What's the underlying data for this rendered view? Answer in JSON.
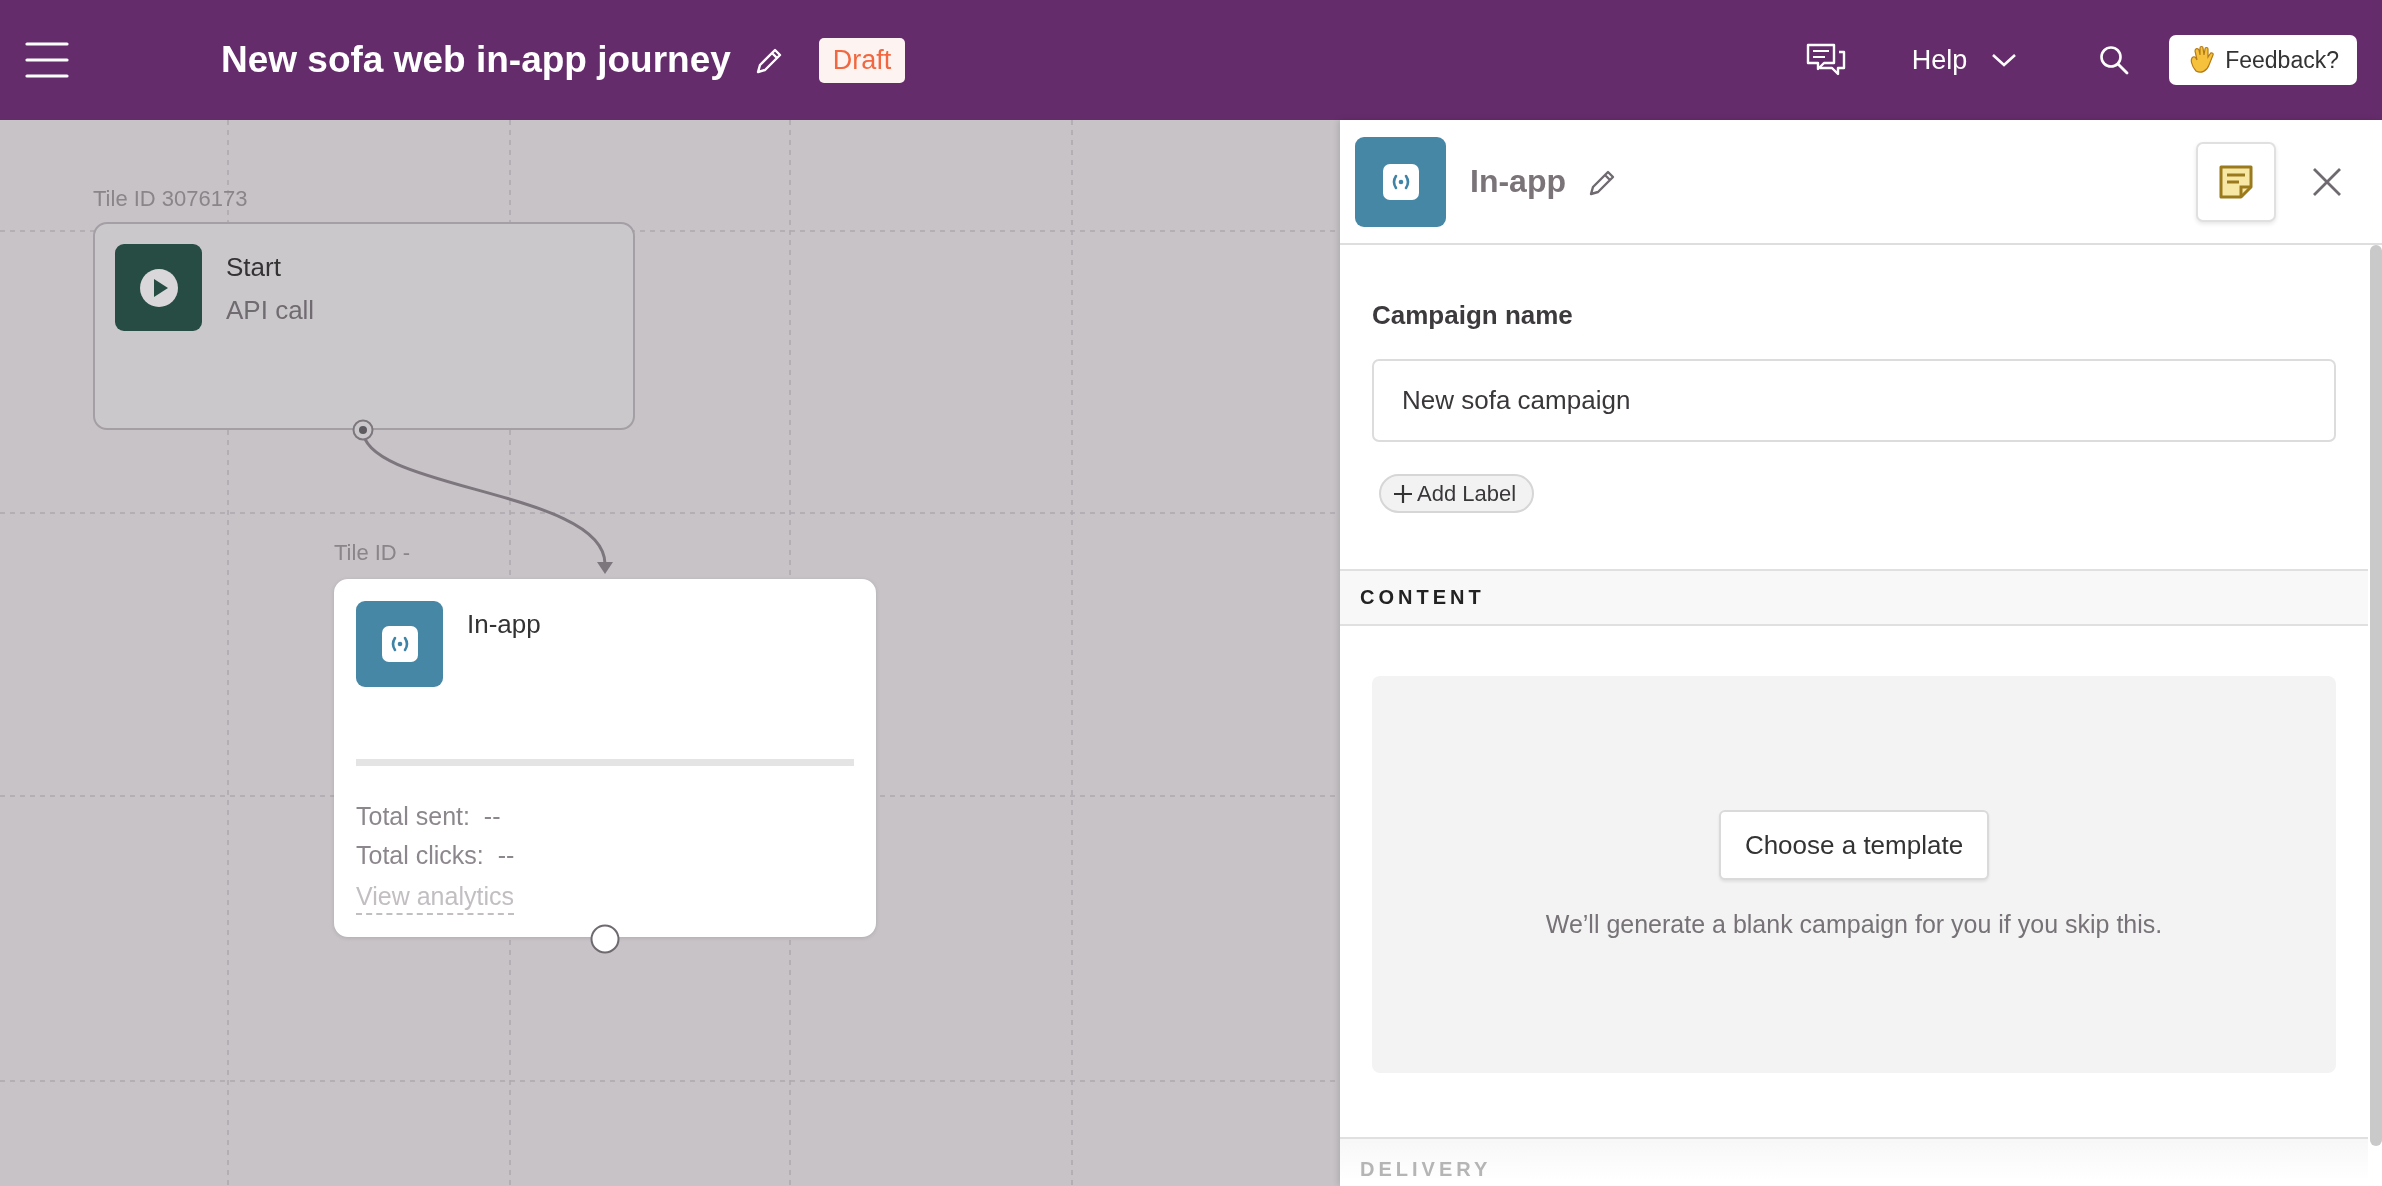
{
  "header": {
    "title": "New sofa web in-app journey",
    "status_badge": "Draft",
    "help_menu": "Help",
    "feedback_button": "Feedback?"
  },
  "canvas": {
    "tiles": [
      {
        "kind": "start",
        "tile_id": "Tile ID 3076173",
        "title": "Start",
        "subtitle": "API call",
        "selected": false
      },
      {
        "kind": "in_app",
        "tile_id": "Tile ID -",
        "title": "In-app",
        "stats": [
          "Total sent:  --",
          "Total clicks:  --"
        ],
        "link": "View analytics",
        "selected": true
      }
    ]
  },
  "panel": {
    "title": "In-app",
    "campaign_name_label": "Campaign name",
    "campaign_name_value": "New sofa campaign",
    "add_label_button": "Add Label",
    "sections": [
      {
        "heading": "CONTENT",
        "template_button": "Choose a template",
        "hint": "We’ll generate a blank campaign for you if you skip this."
      },
      {
        "heading": "DELIVERY"
      }
    ]
  }
}
